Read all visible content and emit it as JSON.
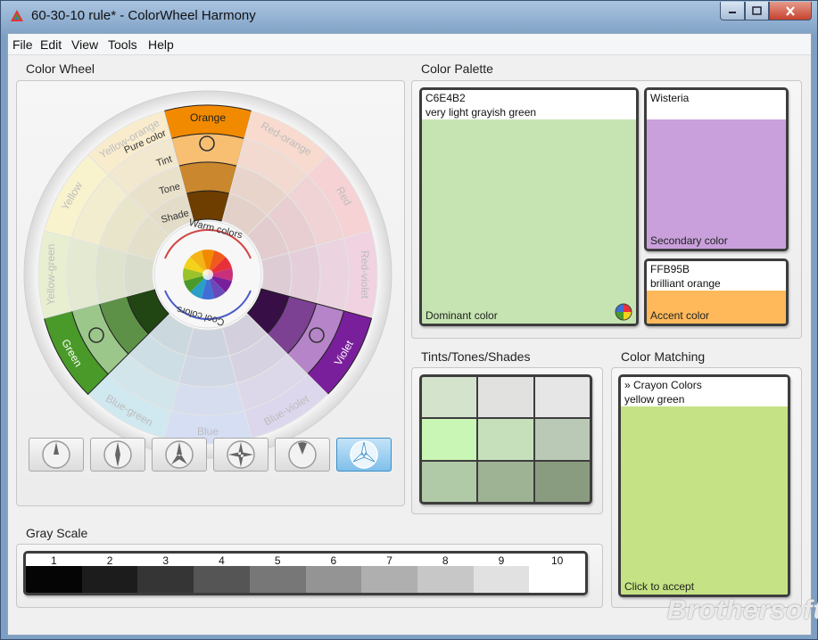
{
  "window": {
    "title": "60-30-10 rule* - ColorWheel Harmony",
    "min_icon": "minimize-icon",
    "max_icon": "maximize-icon",
    "close_icon": "close-icon"
  },
  "menu": [
    "File",
    "Edit",
    "View",
    "Tools",
    "Help"
  ],
  "color_wheel": {
    "title": "Color Wheel",
    "ring_labels": [
      "Pure color",
      "Tint",
      "Tone",
      "Shade"
    ],
    "arc_labels": {
      "warm": "Warm colors",
      "cool": "Cool colors"
    },
    "segments": [
      {
        "name": "Orange",
        "base": "#f28a00",
        "active": true
      },
      {
        "name": "Red-orange",
        "base": "#f05a1c",
        "active": false
      },
      {
        "name": "Red",
        "base": "#e8303a",
        "active": false
      },
      {
        "name": "Red-violet",
        "base": "#c9307a",
        "active": false
      },
      {
        "name": "Violet",
        "base": "#7a1f9c",
        "active": true
      },
      {
        "name": "Blue-violet",
        "base": "#6a4ab8",
        "active": false
      },
      {
        "name": "Blue",
        "base": "#3f6fd6",
        "active": false
      },
      {
        "name": "Blue-green",
        "base": "#2a9fc8",
        "active": false
      },
      {
        "name": "Green",
        "base": "#4a9a2a",
        "active": true
      },
      {
        "name": "Yellow-green",
        "base": "#9cc22a",
        "active": false
      },
      {
        "name": "Yellow",
        "base": "#f2d21a",
        "active": false
      },
      {
        "name": "Yellow-orange",
        "base": "#f4b418",
        "active": false
      }
    ],
    "scheme_buttons": [
      {
        "name": "monochromatic-scheme-button",
        "active": false
      },
      {
        "name": "complementary-scheme-button",
        "active": false
      },
      {
        "name": "split-complementary-scheme-button",
        "active": false
      },
      {
        "name": "tetradic-scheme-button",
        "active": false
      },
      {
        "name": "analogous-scheme-button",
        "active": false
      },
      {
        "name": "triadic-scheme-button",
        "active": true
      }
    ]
  },
  "palette": {
    "title": "Color Palette",
    "dominant": {
      "code": "C6E4B2",
      "name": "very light grayish green",
      "role": "Dominant color",
      "color": "#C6E4B2"
    },
    "secondary": {
      "name": "Wisteria",
      "role": "Secondary color",
      "color": "#C9A0DC"
    },
    "accent": {
      "code": "FFB95B",
      "name": "brilliant orange",
      "role": "Accent color",
      "color": "#FFB95B"
    }
  },
  "tints": {
    "title": "Tints/Tones/Shades",
    "colors": [
      "#d3e3cc",
      "#e1e2e0",
      "#e6e6e6",
      "#c9f5b5",
      "#c6e0bb",
      "#bac8b6",
      "#b0c9a6",
      "#9eb294",
      "#8a9c7f"
    ]
  },
  "matching": {
    "title": "Color Matching",
    "source": "» Crayon Colors",
    "name": "yellow green",
    "hint": "Click to accept",
    "color": "#C5E384"
  },
  "gray_scale": {
    "title": "Gray Scale",
    "steps": [
      {
        "n": "1",
        "color": "#050505"
      },
      {
        "n": "2",
        "color": "#1c1c1c"
      },
      {
        "n": "3",
        "color": "#353535"
      },
      {
        "n": "4",
        "color": "#555555"
      },
      {
        "n": "5",
        "color": "#777777"
      },
      {
        "n": "6",
        "color": "#949494"
      },
      {
        "n": "7",
        "color": "#afafaf"
      },
      {
        "n": "8",
        "color": "#c7c7c7"
      },
      {
        "n": "9",
        "color": "#e1e1e1"
      },
      {
        "n": "10",
        "color": "#ffffff"
      }
    ]
  },
  "watermark": "Brothersoft"
}
